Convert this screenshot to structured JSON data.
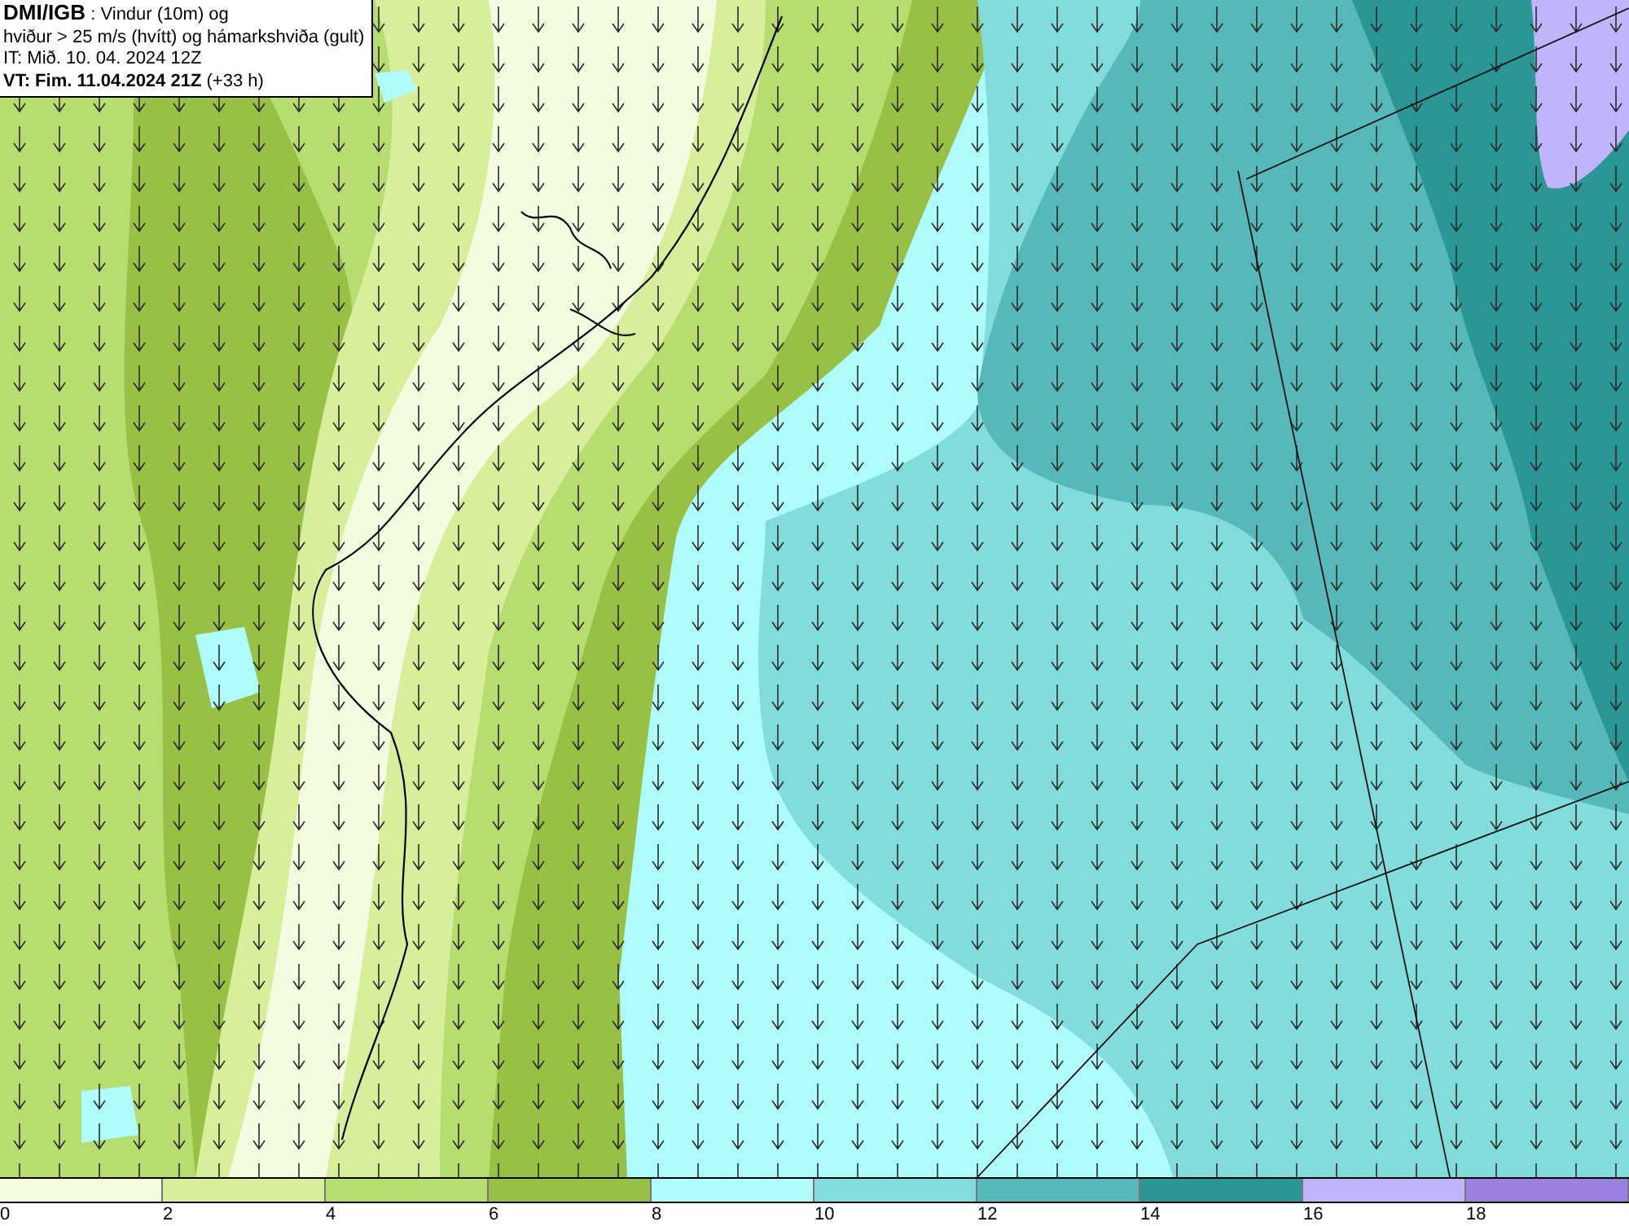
{
  "info_box": {
    "lines": [
      "**DMI/IGB** : Vindur (10m) og",
      "hviður > 25 m/s (hvítt) og hámarkshviða (gult)",
      "IT: Mið. 10. 04. 2024 12Z",
      "**VT: Fim. 11.04.2024 21Z** (+33 h)"
    ]
  },
  "color_legend": {
    "bins": [
      {
        "color": "#f4fce0"
      },
      {
        "color": "#d7ef9a"
      },
      {
        "color": "#b7dc70"
      },
      {
        "color": "#98c044"
      },
      {
        "color": "#aefcfc"
      },
      {
        "color": "#82dcdc"
      },
      {
        "color": "#56b8b8"
      },
      {
        "color": "#2a9696"
      },
      {
        "color": "#c0b4fa"
      },
      {
        "color": "#9c80e0"
      }
    ],
    "ticks": [
      "0",
      "2",
      "4",
      "6",
      "8",
      "10",
      "12",
      "14",
      "16",
      "18"
    ]
  }
}
